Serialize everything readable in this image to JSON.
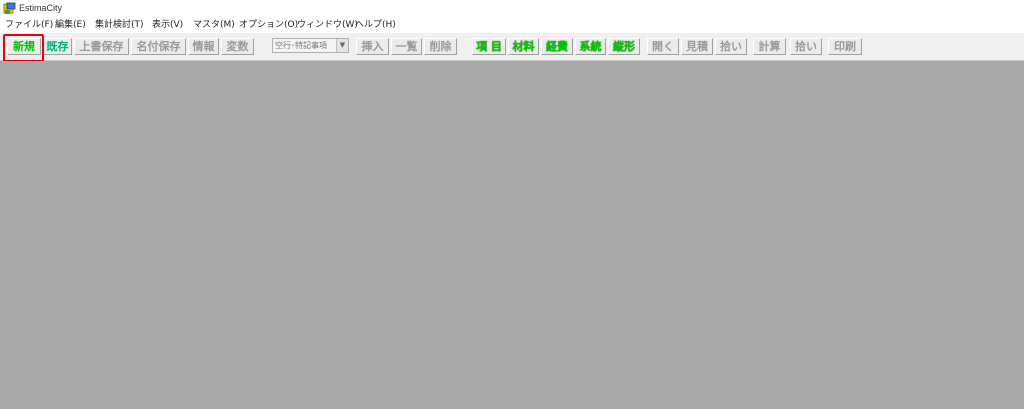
{
  "window": {
    "title": "EstimaCity"
  },
  "menu": [
    "ファイル(F)",
    "編集(E)",
    "集計検討(T)",
    "表示(V)",
    "マスタ(M)",
    "オプション(O)",
    "ウィンドウ(W)",
    "ヘルプ(H)"
  ],
  "toolbar": {
    "new": "新規",
    "existing": "既存",
    "overwrite_save": "上書保存",
    "save_as": "名付保存",
    "info": "情報",
    "variables": "変数",
    "row_type_select": "空行･特記事項",
    "insert": "挿入",
    "list": "一覧",
    "delete": "削除",
    "item": "項 目",
    "material": "材料",
    "expenses": "経費",
    "system": "系統",
    "shape": "縦形",
    "open": "開く",
    "estimate": "見積",
    "takeoff": "拾い",
    "calculate": "計算",
    "takeoff2": "拾い",
    "print": "印刷"
  },
  "colors": {
    "highlight_border": "#e60012",
    "active_label": "#00cc00",
    "workspace": "#a9a9a9"
  }
}
